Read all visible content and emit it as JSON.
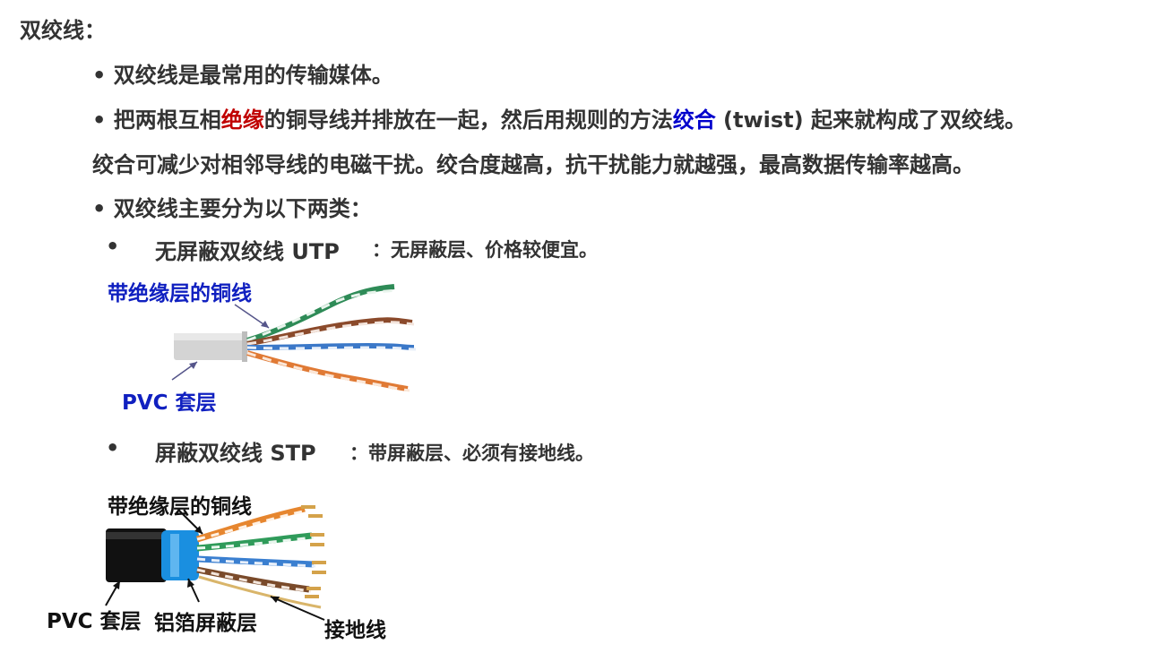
{
  "heading": "双绞线：",
  "bullets": {
    "b1": "• 双绞线是最常用的传输媒体。",
    "b2_pre": "• 把两根互相",
    "b2_red": "绝缘",
    "b2_mid": "的铜导线并排放在一起，然后用规则的方法",
    "b2_blue": "绞合",
    "b2_post": " (twist) 起来就构成了双绞线。",
    "b3": "绞合可减少对相邻导线的电磁干扰。绞合度越高，抗干扰能力就越强，最高数据传输率越高。",
    "b4": "• 双绞线主要分为以下两类："
  },
  "types": {
    "utp": {
      "dot": "•",
      "name": "无屏蔽双绞线 UTP",
      "desc": "：无屏蔽层、价格较便宜。"
    },
    "stp": {
      "dot": "•",
      "name": "屏蔽双绞线 STP",
      "desc": "：带屏蔽层、必须有接地线。"
    }
  },
  "utp_figure": {
    "label_insulated": "带绝缘层的铜线",
    "label_pvc": "PVC 套层"
  },
  "stp_figure": {
    "label_insulated": "带绝缘层的铜线",
    "label_pvc": "PVC 套层",
    "label_foil": "铝箔屏蔽层",
    "label_ground": "接地线"
  },
  "colors": {
    "text": "#333333",
    "red_emphasis": "#c00000",
    "blue_emphasis": "#0000cc",
    "callout_blue": "#1020c0",
    "shield_blue": "#1a8fe0"
  }
}
